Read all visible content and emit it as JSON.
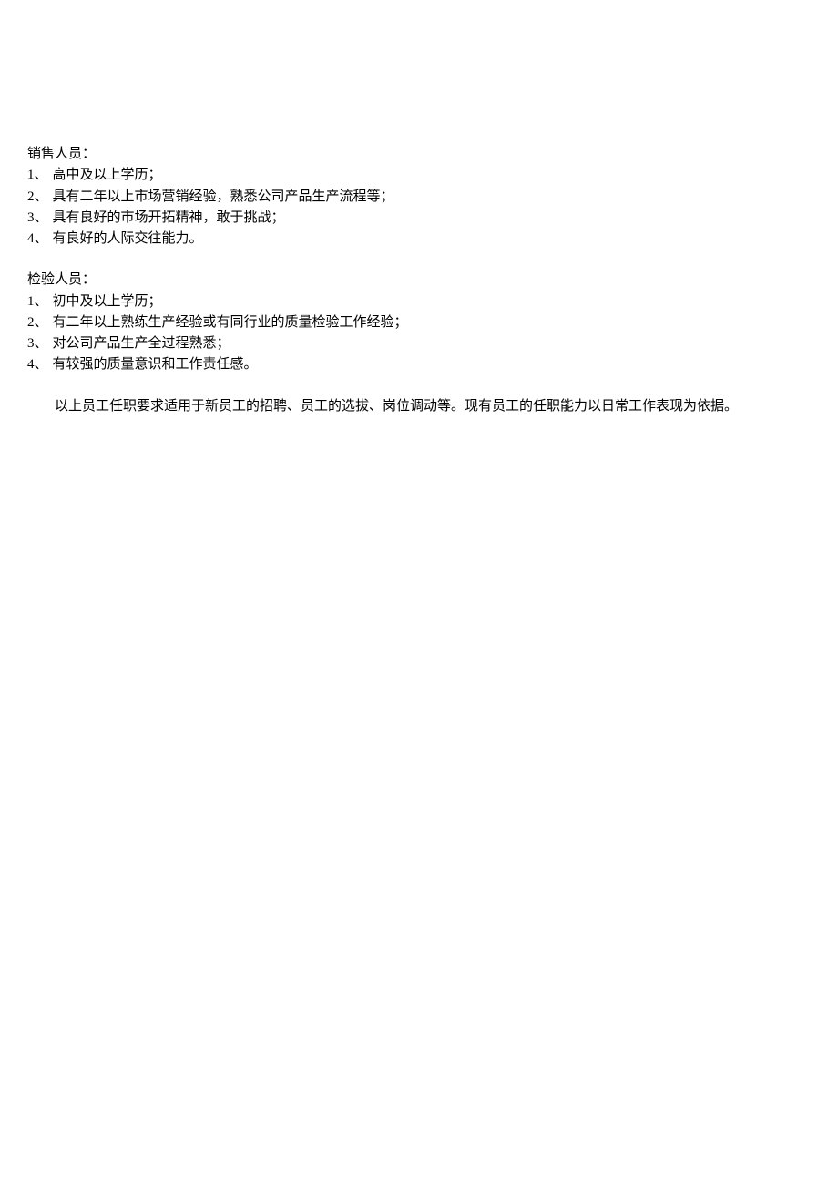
{
  "sections": [
    {
      "title": "销售人员：",
      "items": [
        {
          "num": "1、",
          "text": "高中及以上学历；"
        },
        {
          "num": "2、",
          "text": "具有二年以上市场营销经验，熟悉公司产品生产流程等；"
        },
        {
          "num": "3、",
          "text": "具有良好的市场开拓精神，敢于挑战；"
        },
        {
          "num": "4、",
          "text": "有良好的人际交往能力。"
        }
      ]
    },
    {
      "title": "检验人员：",
      "items": [
        {
          "num": "1、",
          "text": "初中及以上学历；"
        },
        {
          "num": "2、",
          "text": "有二年以上熟练生产经验或有同行业的质量检验工作经验；"
        },
        {
          "num": "3、",
          "text": "对公司产品生产全过程熟悉；"
        },
        {
          "num": "4、",
          "text": "有较强的质量意识和工作责任感。"
        }
      ]
    }
  ],
  "summary": "以上员工任职要求适用于新员工的招聘、员工的选拔、岗位调动等。现有员工的任职能力以日常工作表现为依据。"
}
